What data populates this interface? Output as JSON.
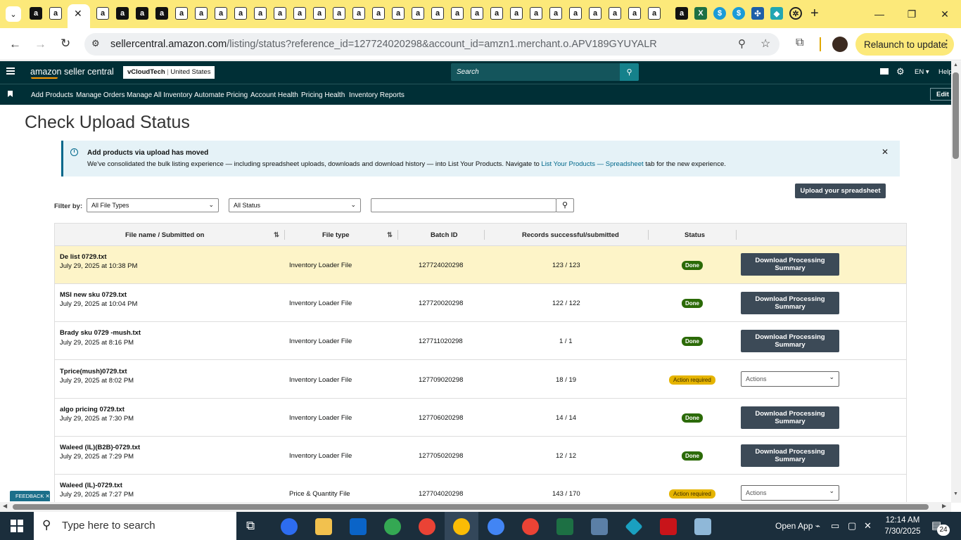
{
  "browser": {
    "url_domain": "sellercentral.amazon.com",
    "url_path": "/listing/status?reference_id=127724020298&account_id=amzn1.merchant.o.APV189GYUYALR",
    "relaunch_label": "Relaunch to update"
  },
  "header": {
    "logo_text": "amazon seller central",
    "account_name": "vCloudTech",
    "account_region": "United States",
    "search_placeholder": "Search",
    "language": "EN",
    "help": "Help"
  },
  "nav": {
    "items": [
      "Add Products",
      "Manage Orders",
      "Manage All Inventory",
      "Automate Pricing",
      "Account Health",
      "Pricing Health",
      "Inventory Reports"
    ],
    "edit": "Edit"
  },
  "page": {
    "title": "Check Upload Status",
    "banner": {
      "title": "Add products via upload has moved",
      "body_prefix": "We've consolidated the bulk listing experience — including spreadsheet uploads, downloads and download history — into List Your Products. Navigate to ",
      "link": "List Your Products — Spreadsheet",
      "body_suffix": " tab for the new experience."
    },
    "filter_label": "Filter by:",
    "file_type_filter": "All File Types",
    "status_filter": "All Status",
    "upload_button": "Upload your spreadsheet",
    "feedback": "FEEDBACK"
  },
  "table": {
    "headers": [
      "File name / Submitted on",
      "File type",
      "Batch ID",
      "Records successful/submitted",
      "Status"
    ],
    "rows": [
      {
        "name": "De list 0729.txt",
        "date": "July 29, 2025 at 10:38 PM",
        "type": "Inventory Loader File",
        "batch": "127724020298",
        "records": "123 / 123",
        "status": "Done",
        "action": "Download Processing Summary"
      },
      {
        "name": "MSI new sku 0729.txt",
        "date": "July 29, 2025 at 10:04 PM",
        "type": "Inventory Loader File",
        "batch": "127720020298",
        "records": "122 / 122",
        "status": "Done",
        "action": "Download Processing Summary"
      },
      {
        "name": "Brady sku 0729 -mush.txt",
        "date": "July 29, 2025 at 8:16 PM",
        "type": "Inventory Loader File",
        "batch": "127711020298",
        "records": "1 / 1",
        "status": "Done",
        "action": "Download Processing Summary"
      },
      {
        "name": "Tprice(mush)0729.txt",
        "date": "July 29, 2025 at 8:02 PM",
        "type": "Inventory Loader File",
        "batch": "127709020298",
        "records": "18 / 19",
        "status": "Action required",
        "action": "Actions"
      },
      {
        "name": "algo pricing 0729.txt",
        "date": "July 29, 2025 at 7:30 PM",
        "type": "Inventory Loader File",
        "batch": "127706020298",
        "records": "14 / 14",
        "status": "Done",
        "action": "Download Processing Summary"
      },
      {
        "name": "Waleed (IL)(B2B)-0729.txt",
        "date": "July 29, 2025 at 7:29 PM",
        "type": "Inventory Loader File",
        "batch": "127705020298",
        "records": "12 / 12",
        "status": "Done",
        "action": "Download Processing Summary"
      },
      {
        "name": "Waleed (IL)-0729.txt",
        "date": "July 29, 2025 at 7:27 PM",
        "type": "Price & Quantity File",
        "batch": "127704020298",
        "records": "143 / 170",
        "status": "Action required",
        "action": "Actions"
      }
    ]
  },
  "taskbar": {
    "search_placeholder": "Type here to search",
    "open_app": "Open App",
    "time": "12:14 AM",
    "date": "7/30/2025",
    "notifications": "24"
  }
}
